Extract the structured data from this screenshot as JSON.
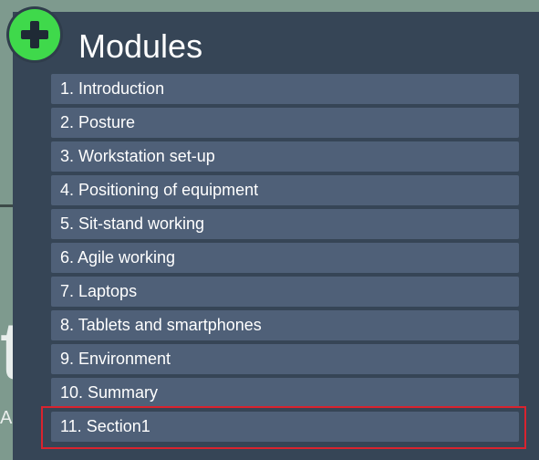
{
  "panel": {
    "title": "Modules",
    "add_icon": "plus-circle-icon"
  },
  "modules": [
    {
      "label": "1. Introduction"
    },
    {
      "label": "2. Posture"
    },
    {
      "label": "3. Workstation set-up"
    },
    {
      "label": "4. Positioning of equipment"
    },
    {
      "label": "5. Sit-stand working"
    },
    {
      "label": "6. Agile working"
    },
    {
      "label": "7. Laptops"
    },
    {
      "label": "8. Tablets and smartphones"
    },
    {
      "label": "9. Environment"
    },
    {
      "label": "10. Summary"
    },
    {
      "label": "11. Section1",
      "highlighted": true
    }
  ],
  "background": {
    "glyph": "t",
    "caption": "AIN"
  },
  "colors": {
    "background": "#7e9a8e",
    "panel": "#364556",
    "item": "#4f6078",
    "accent_green": "#3fd94b",
    "highlight": "#d9232e"
  }
}
